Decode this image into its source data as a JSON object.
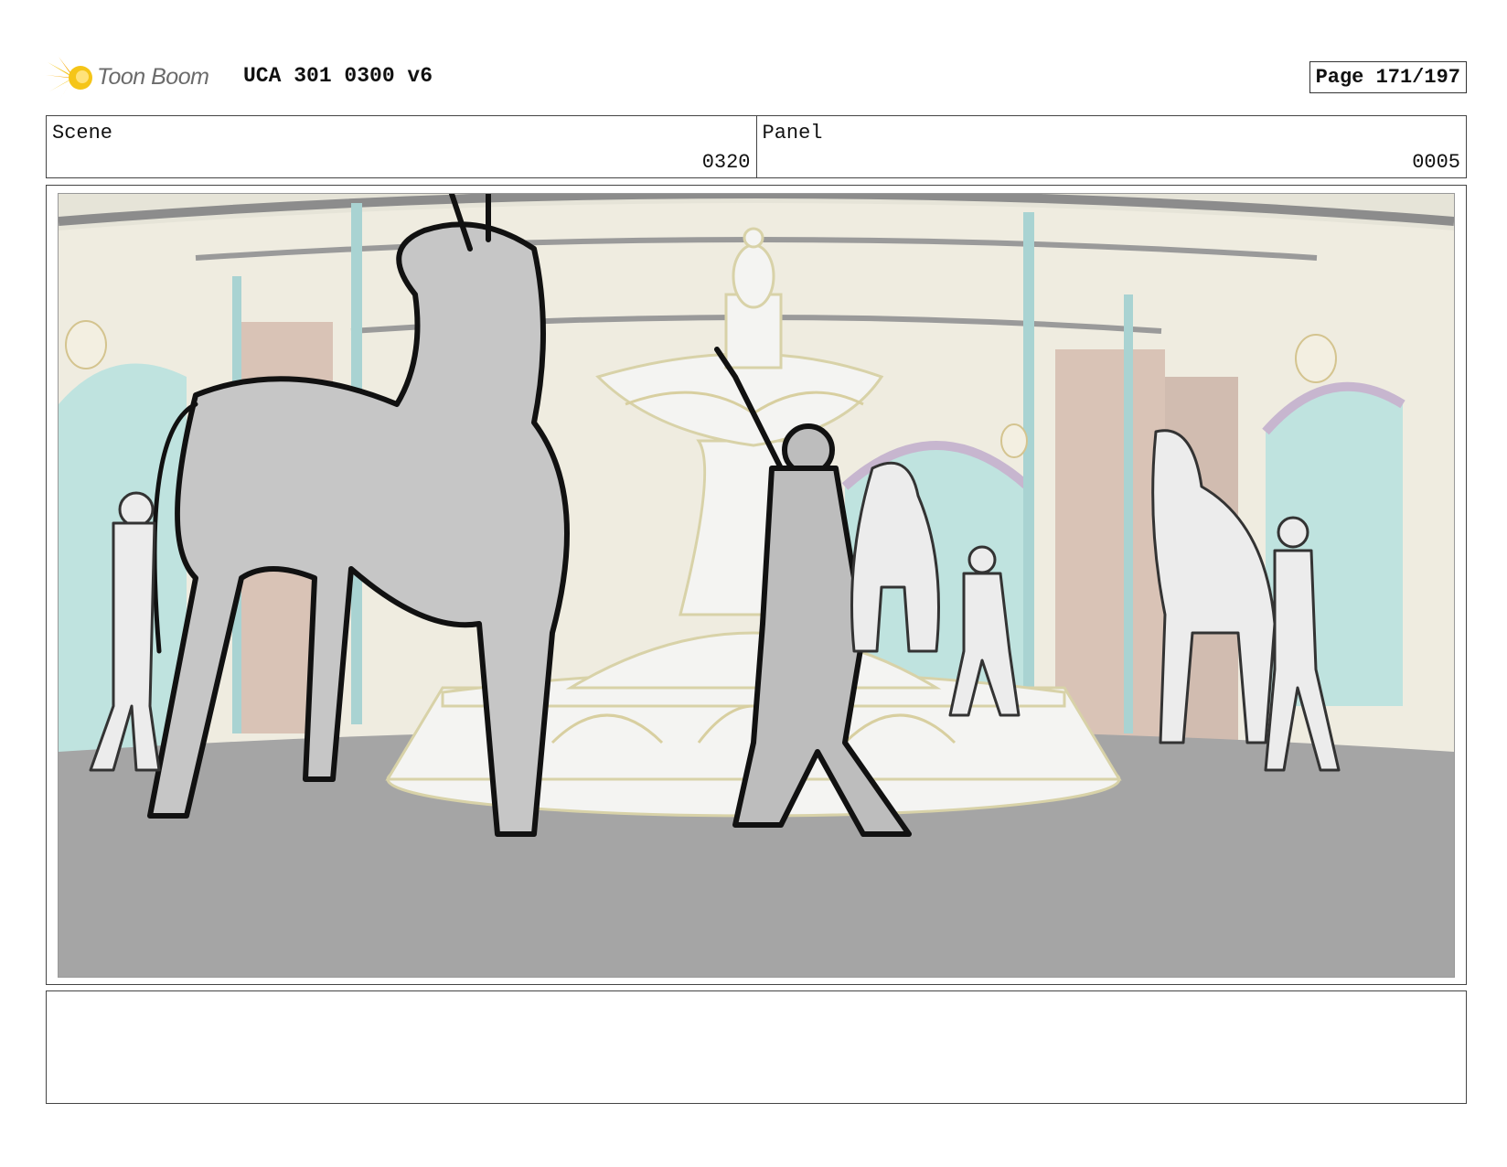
{
  "header": {
    "logo_text": "Toon Boom",
    "doc_title": "UCA 301 0300 v6",
    "page_label": "Page 171/197"
  },
  "scene": {
    "label": "Scene",
    "value": "0320"
  },
  "panel": {
    "label": "Panel",
    "value": "0005"
  },
  "notes": {
    "text": ""
  },
  "colors": {
    "frame_border": "#444444",
    "logo_yellow": "#f5c518",
    "logo_text": "#6b6b6b",
    "floor_gray": "#a5a5a5",
    "wall_cream": "#efece0",
    "window_teal": "#bfe3df"
  }
}
